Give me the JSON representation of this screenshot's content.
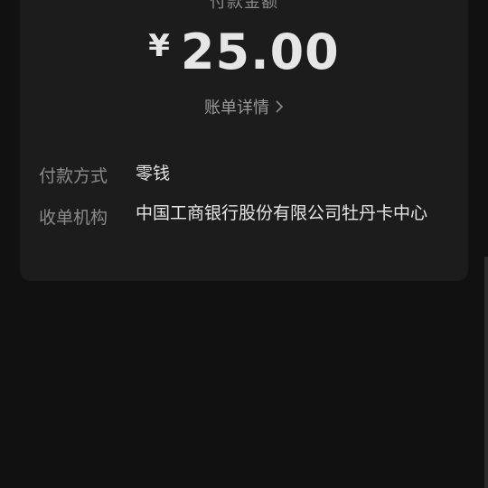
{
  "payment": {
    "amount_label": "付款金额",
    "currency_symbol": "¥",
    "amount": "25.00",
    "bill_details_label": "账单详情"
  },
  "details": {
    "method_label": "付款方式",
    "method_value": "零钱",
    "merchant_label": "收单机构",
    "merchant_value": "中国工商银行股份有限公司牡丹卡中心"
  },
  "colors": {
    "background": "#111111",
    "card": "#1c1c1c",
    "primary_text": "#e6e6e6",
    "secondary_text": "#8a8a8a"
  },
  "icons": {
    "bill_link_icon": "chevron-right-icon"
  }
}
